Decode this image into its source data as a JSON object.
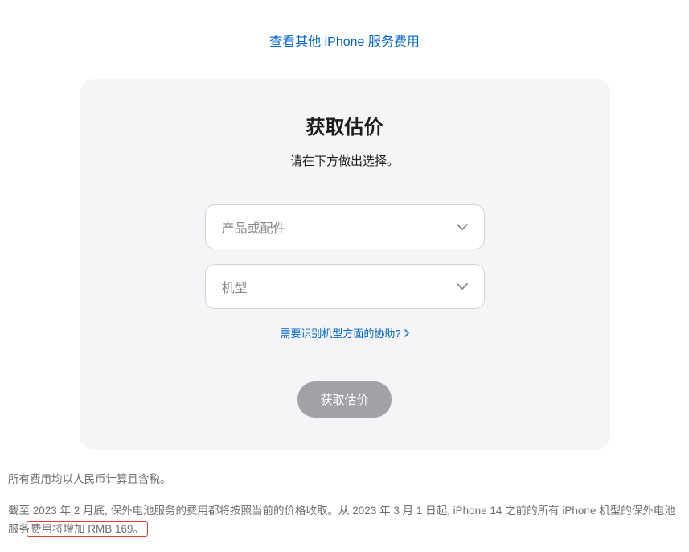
{
  "topLink": {
    "text": "查看其他 iPhone 服务费用"
  },
  "card": {
    "title": "获取估价",
    "subtitle": "请在下方做出选择。",
    "select1": {
      "placeholder": "产品或配件"
    },
    "select2": {
      "placeholder": "机型"
    },
    "helpLink": {
      "text": "需要识别机型方面的协助?"
    },
    "submitButton": {
      "label": "获取估价"
    }
  },
  "footer": {
    "line1": "所有费用均以人民币计算且含税。",
    "line2a": "截至 2023 年 2 月底, 保外电池服务的费用都将按照当前的价格收取。从 2023 年 3 月 1 日起, iPhone 14 之前的所有 iPhone 机型的保外电池服务",
    "line2b": "费用将增加 RMB 169。"
  }
}
